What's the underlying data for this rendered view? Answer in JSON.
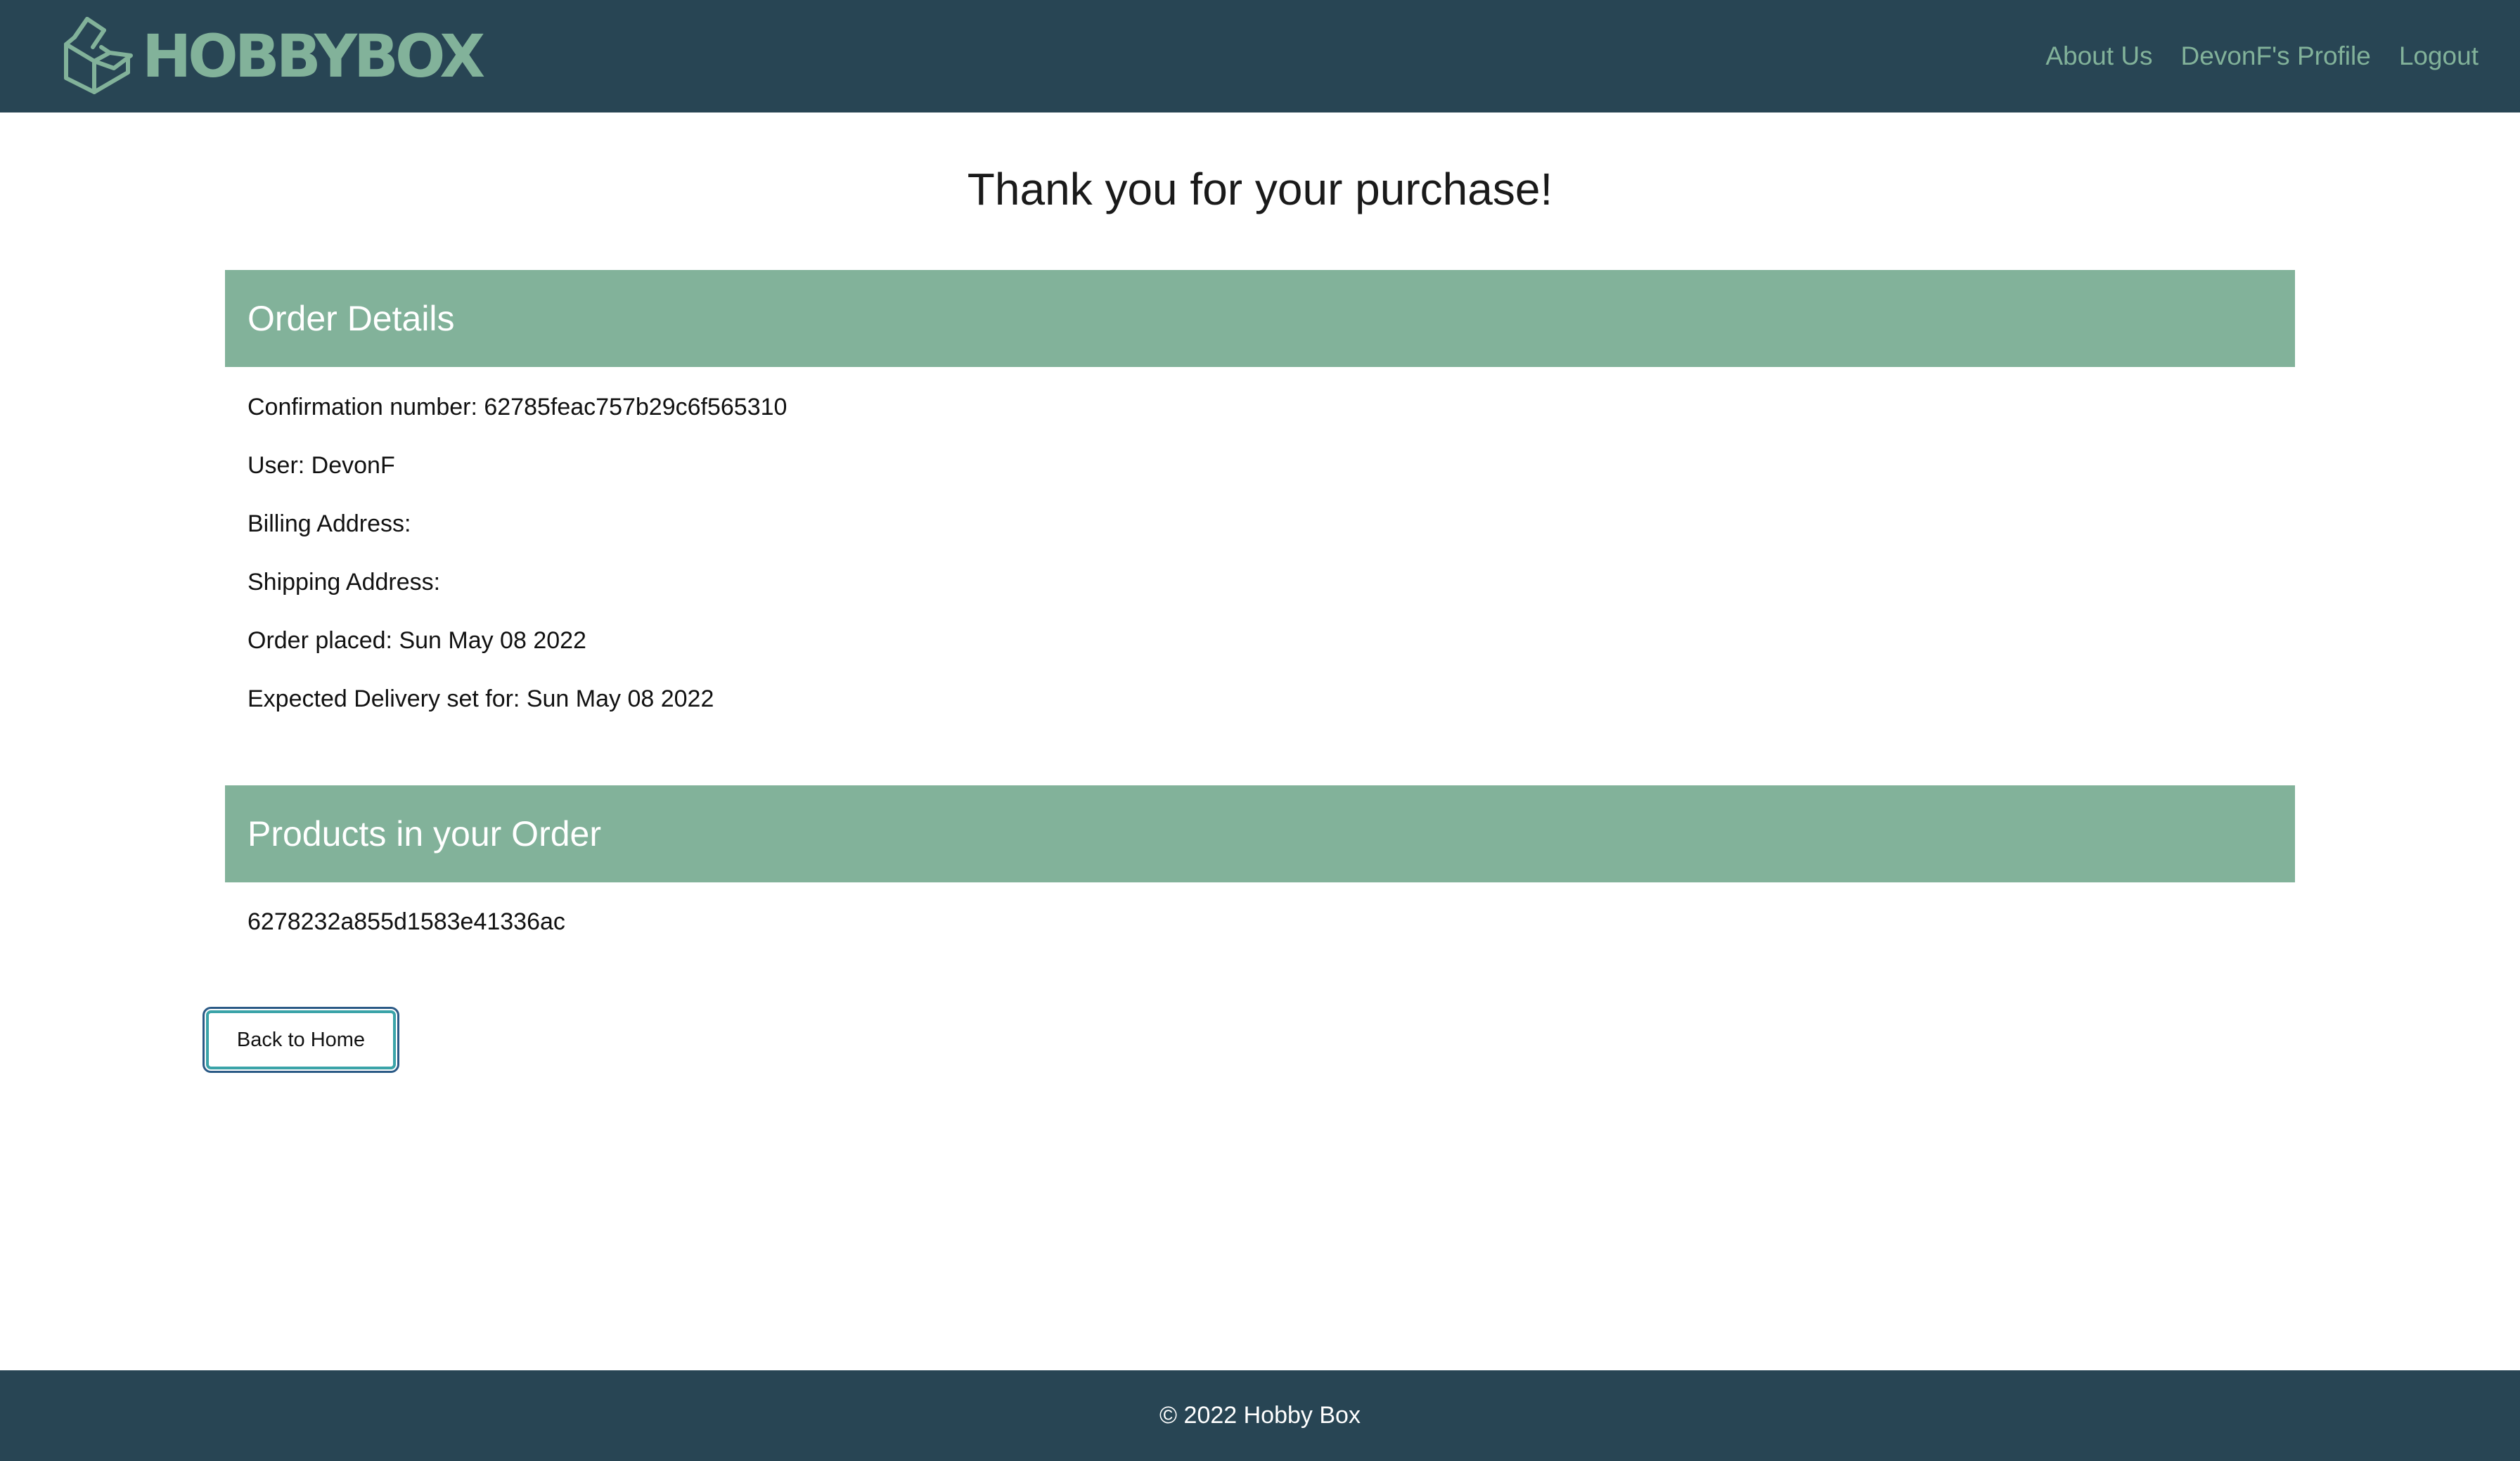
{
  "header": {
    "brand_name": "HOBBYBOX",
    "nav": {
      "about_label": "About Us",
      "profile_label": "DevonF's Profile",
      "logout_label": "Logout"
    }
  },
  "main": {
    "title": "Thank you for your purchase!",
    "order_details": {
      "heading": "Order Details",
      "confirmation": "Confirmation number: 62785feac757b29c6f565310",
      "user": "User: DevonF",
      "billing_address": "Billing Address:",
      "shipping_address": "Shipping Address:",
      "order_placed": "Order placed: Sun May 08 2022",
      "expected_delivery": "Expected Delivery set for: Sun May 08 2022"
    },
    "products": {
      "heading": "Products in your Order",
      "items": [
        "6278232a855d1583e41336ac"
      ]
    },
    "back_button_label": "Back to Home"
  },
  "footer": {
    "copyright": "© 2022 Hobby Box"
  },
  "colors": {
    "navbar_bg": "#284554",
    "accent_green": "#82b29a",
    "footer_bg": "#284554"
  },
  "icons": {
    "logo": "open-box-icon"
  }
}
